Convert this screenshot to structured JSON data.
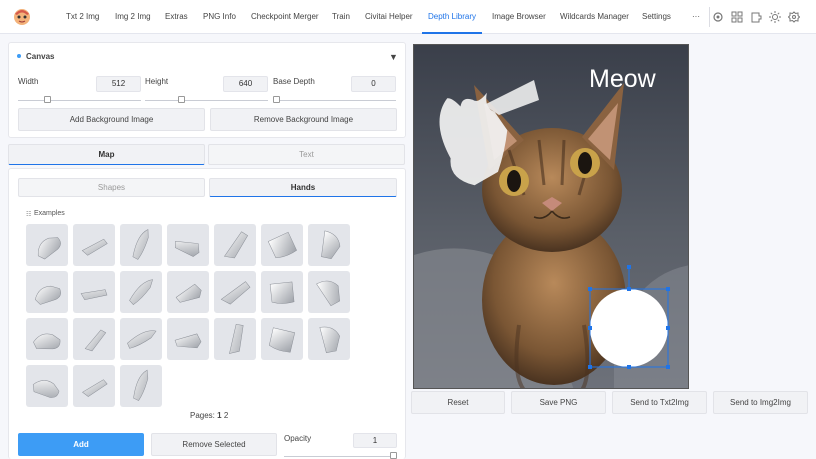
{
  "nav": {
    "tabs": [
      {
        "label": "Txt 2 Img"
      },
      {
        "label": "Img 2 Img"
      },
      {
        "label": "Extras"
      },
      {
        "label": "PNG Info"
      },
      {
        "label": "Checkpoint Merger"
      },
      {
        "label": "Train"
      },
      {
        "label": "Civitai Helper"
      },
      {
        "label": "Depth Library"
      },
      {
        "label": "Image Browser"
      },
      {
        "label": "Wildcards Manager"
      },
      {
        "label": "Settings"
      }
    ],
    "active_tab": "Depth Library",
    "more": "···",
    "icons": [
      "gear-icon",
      "grid-icon",
      "puzzle-icon",
      "sun-icon",
      "settings-cog-icon"
    ]
  },
  "canvas": {
    "title": "Canvas",
    "collapse_glyph": "▼",
    "width_label": "Width",
    "width_value": "512",
    "height_label": "Height",
    "height_value": "640",
    "base_depth_label": "Base Depth",
    "base_depth_value": "0",
    "add_bg_label": "Add Background Image",
    "remove_bg_label": "Remove Background Image"
  },
  "tabs": {
    "map": "Map",
    "text": "Text",
    "shapes": "Shapes",
    "hands": "Hands"
  },
  "examples": {
    "label": "Examples",
    "icon": "list-icon",
    "count": 24
  },
  "pages": {
    "label": "Pages:",
    "current": "1",
    "next": "2"
  },
  "actions": {
    "add": "Add",
    "remove_selected": "Remove Selected",
    "opacity_label": "Opacity",
    "opacity_value": "1"
  },
  "preview": {
    "caption": "Meow"
  },
  "bottom_buttons": {
    "reset": "Reset",
    "save_png": "Save PNG",
    "send_txt2img": "Send to Txt2Img",
    "send_img2img": "Send to Img2Img"
  },
  "colors": {
    "accent": "#1f74e8",
    "primary_button": "#3d9cf5",
    "selection": "#1f74e8"
  }
}
